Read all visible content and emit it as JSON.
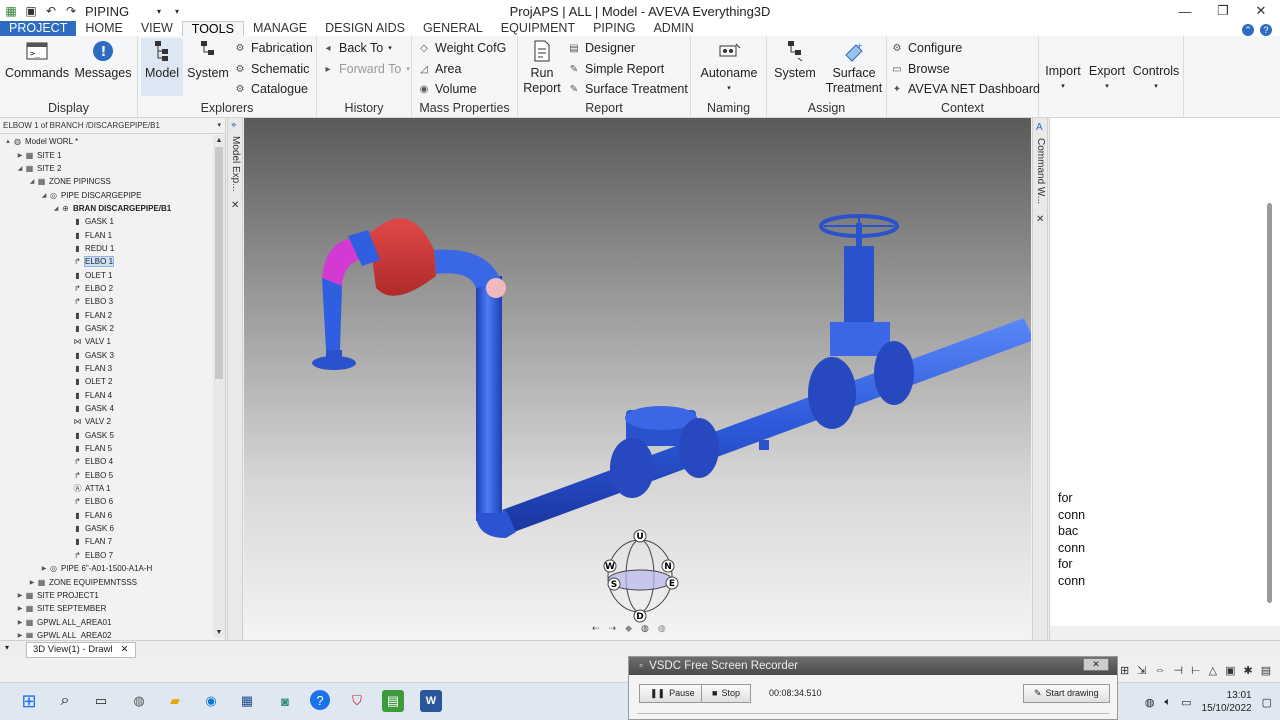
{
  "window": {
    "title": "ProjAPS | ALL | Model - AVEVA Everything3D",
    "quick_combo": "PIPING",
    "controls": [
      "—",
      "❐",
      "✕"
    ]
  },
  "tabs": [
    "PROJECT",
    "HOME",
    "VIEW",
    "TOOLS",
    "MANAGE",
    "DESIGN AIDS",
    "GENERAL",
    "EQUIPMENT",
    "PIPING",
    "ADMIN"
  ],
  "active_tab": "TOOLS",
  "ribbon": {
    "display": {
      "label": "Display",
      "commands": "Commands",
      "messages": "Messages"
    },
    "explorers": {
      "label": "Explorers",
      "model": "Model",
      "system": "System",
      "fabrication": "Fabrication",
      "schematic": "Schematic",
      "catalogue": "Catalogue"
    },
    "history": {
      "label": "History",
      "back_to": "Back To",
      "forward_to": "Forward To"
    },
    "mass": {
      "label": "Mass Properties",
      "weight": "Weight  CofG",
      "area": "Area",
      "volume": "Volume"
    },
    "report": {
      "label": "Report",
      "run_report_1": "Run",
      "run_report_2": "Report",
      "designer": "Designer",
      "simple_report": "Simple Report",
      "surface_treatment": "Surface Treatment"
    },
    "naming": {
      "label": "Naming",
      "autoname": "Autoname"
    },
    "assign": {
      "label": "Assign",
      "system": "System",
      "surface_1": "Surface",
      "surface_2": "Treatment"
    },
    "context": {
      "label": "Context",
      "configure": "Configure",
      "browse": "Browse",
      "dashboard": "AVEVA NET Dashboard"
    },
    "import": "Import",
    "export": "Export",
    "controls": "Controls"
  },
  "explorer": {
    "header": "ELBOW 1 of BRANCH /DISCARGEPIPE/B1",
    "side_label": "Model Exp...",
    "tree": [
      {
        "label": "Model WORL *",
        "level": 0,
        "exp": "▲",
        "icon": "◍"
      },
      {
        "label": "SITE 1",
        "level": 1,
        "exp": "▶",
        "icon": "▦"
      },
      {
        "label": "SITE 2",
        "level": 1,
        "exp": "◢",
        "icon": "▦"
      },
      {
        "label": "ZONE PIPINCSS",
        "level": 2,
        "exp": "◢",
        "icon": "▦"
      },
      {
        "label": "PIPE DISCARGEPIPE",
        "level": 3,
        "exp": "◢",
        "icon": "◎"
      },
      {
        "label": "BRAN DISCARGEPIPE/B1",
        "level": 4,
        "exp": "◢",
        "icon": "⊕",
        "bold": true
      },
      {
        "label": "GASK 1",
        "level": 5,
        "icon": "▮"
      },
      {
        "label": "FLAN 1",
        "level": 5,
        "icon": "▮"
      },
      {
        "label": "REDU 1",
        "level": 5,
        "icon": "▮"
      },
      {
        "label": "ELBO 1",
        "level": 5,
        "icon": "↱",
        "sel": true
      },
      {
        "label": "OLET 1",
        "level": 5,
        "icon": "▮"
      },
      {
        "label": "ELBO 2",
        "level": 5,
        "icon": "↱"
      },
      {
        "label": "ELBO 3",
        "level": 5,
        "icon": "↱"
      },
      {
        "label": "FLAN 2",
        "level": 5,
        "icon": "▮"
      },
      {
        "label": "GASK 2",
        "level": 5,
        "icon": "▮"
      },
      {
        "label": "VALV 1",
        "level": 5,
        "icon": "⋈"
      },
      {
        "label": "GASK 3",
        "level": 5,
        "icon": "▮"
      },
      {
        "label": "FLAN 3",
        "level": 5,
        "icon": "▮"
      },
      {
        "label": "OLET 2",
        "level": 5,
        "icon": "▮"
      },
      {
        "label": "FLAN 4",
        "level": 5,
        "icon": "▮"
      },
      {
        "label": "GASK 4",
        "level": 5,
        "icon": "▮"
      },
      {
        "label": "VALV 2",
        "level": 5,
        "icon": "⋈"
      },
      {
        "label": "GASK 5",
        "level": 5,
        "icon": "▮"
      },
      {
        "label": "FLAN 5",
        "level": 5,
        "icon": "▮"
      },
      {
        "label": "ELBO 4",
        "level": 5,
        "icon": "↱"
      },
      {
        "label": "ELBO 5",
        "level": 5,
        "icon": "↱"
      },
      {
        "label": "ATTA 1",
        "level": 5,
        "icon": "Ⓐ"
      },
      {
        "label": "ELBO 6",
        "level": 5,
        "icon": "↱"
      },
      {
        "label": "FLAN 6",
        "level": 5,
        "icon": "▮"
      },
      {
        "label": "GASK 6",
        "level": 5,
        "icon": "▮"
      },
      {
        "label": "FLAN 7",
        "level": 5,
        "icon": "▮"
      },
      {
        "label": "ELBO 7",
        "level": 5,
        "icon": "↱"
      },
      {
        "label": "PIPE 6\"-A01-1500-A1A-H",
        "level": 3,
        "exp": "▶",
        "icon": "◎"
      },
      {
        "label": "ZONE EQUIPEMNTSSS",
        "level": 2,
        "exp": "▶",
        "icon": "▦"
      },
      {
        "label": "SITE PROJECT1",
        "level": 1,
        "exp": "▶",
        "icon": "▦"
      },
      {
        "label": "SITE SEPTEMBER",
        "level": 1,
        "exp": "▶",
        "icon": "▦"
      },
      {
        "label": "GPWL ALL_AREA01",
        "level": 1,
        "exp": "▶",
        "icon": "▦"
      },
      {
        "label": "GPWL ALL_AREA02",
        "level": 1,
        "exp": "▶",
        "icon": "▦"
      }
    ]
  },
  "viewcube": {
    "u": "U",
    "d": "D",
    "w": "W",
    "n": "N",
    "s": "S",
    "e": "E"
  },
  "command_window": {
    "side_label": "Command W...",
    "lines": [
      "for",
      "conn",
      "bac",
      "conn",
      "for",
      "conn"
    ]
  },
  "doc_tab": {
    "label": "3D View(1) - Drawl",
    "close": "✕"
  },
  "recorder": {
    "title": "VSDC Free Screen Recorder",
    "pause": "Pause",
    "stop": "Stop",
    "time": "00:08:34.510",
    "start_drawing": "Start drawing",
    "close": "✕"
  },
  "clock": {
    "time": "13:01",
    "date": "15/10/2022"
  },
  "colors": {
    "pipe": "#2f5fe0",
    "reducer": "#d43c3c",
    "elbow_selected": "#d23ad2",
    "accent": "#2d6cc0"
  }
}
